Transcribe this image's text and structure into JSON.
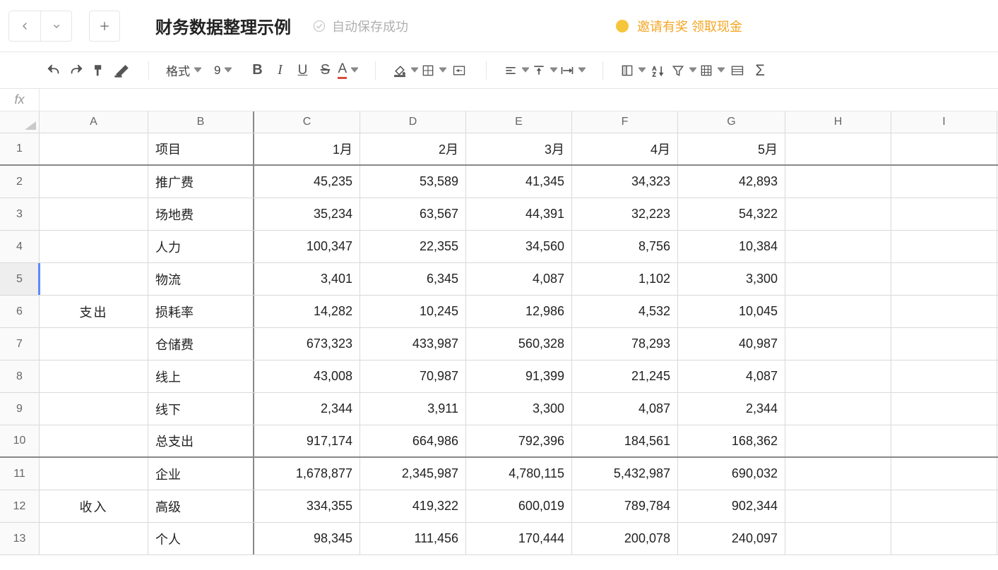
{
  "header": {
    "title": "财务数据整理示例",
    "save_status": "自动保存成功",
    "promo": "邀请有奖 领取现金"
  },
  "toolbar": {
    "format_label": "格式",
    "font_size": "9"
  },
  "formula_bar": {
    "label": "fx",
    "value": ""
  },
  "columns": [
    "A",
    "B",
    "C",
    "D",
    "E",
    "F",
    "G",
    "H",
    "I"
  ],
  "column_widths": [
    "colA",
    "colB",
    "colC",
    "colD",
    "colE",
    "colF",
    "colG",
    "colH",
    "colI"
  ],
  "rows": [
    {
      "n": "1",
      "a": "",
      "b": "项目",
      "c": "1月",
      "d": "2月",
      "e": "3月",
      "f": "4月",
      "g": "5月",
      "header": true
    },
    {
      "n": "2",
      "a": "",
      "b": "推广费",
      "c": "45,235",
      "d": "53,589",
      "e": "41,345",
      "f": "34,323",
      "g": "42,893"
    },
    {
      "n": "3",
      "a": "",
      "b": "场地费",
      "c": "35,234",
      "d": "63,567",
      "e": "44,391",
      "f": "32,223",
      "g": "54,322"
    },
    {
      "n": "4",
      "a": "",
      "b": "人力",
      "c": "100,347",
      "d": "22,355",
      "e": "34,560",
      "f": "8,756",
      "g": "10,384"
    },
    {
      "n": "5",
      "a": "",
      "b": "物流",
      "c": "3,401",
      "d": "6,345",
      "e": "4,087",
      "f": "1,102",
      "g": "3,300",
      "sel": true
    },
    {
      "n": "6",
      "a": "支出",
      "b": "损耗率",
      "c": "14,282",
      "d": "10,245",
      "e": "12,986",
      "f": "4,532",
      "g": "10,045"
    },
    {
      "n": "7",
      "a": "",
      "b": "仓储费",
      "c": "673,323",
      "d": "433,987",
      "e": "560,328",
      "f": "78,293",
      "g": "40,987"
    },
    {
      "n": "8",
      "a": "",
      "b": "线上",
      "c": "43,008",
      "d": "70,987",
      "e": "91,399",
      "f": "21,245",
      "g": "4,087"
    },
    {
      "n": "9",
      "a": "",
      "b": "线下",
      "c": "2,344",
      "d": "3,911",
      "e": "3,300",
      "f": "4,087",
      "g": "2,344"
    },
    {
      "n": "10",
      "a": "",
      "b": "总支出",
      "c": "917,174",
      "d": "664,986",
      "e": "792,396",
      "f": "184,561",
      "g": "168,362",
      "thick": true
    },
    {
      "n": "11",
      "a": "",
      "b": "企业",
      "c": "1,678,877",
      "d": "2,345,987",
      "e": "4,780,115",
      "f": "5,432,987",
      "g": "690,032"
    },
    {
      "n": "12",
      "a": "收入",
      "b": "高级",
      "c": "334,355",
      "d": "419,322",
      "e": "600,019",
      "f": "789,784",
      "g": "902,344"
    },
    {
      "n": "13",
      "a": "",
      "b": "个人",
      "c": "98,345",
      "d": "111,456",
      "e": "170,444",
      "f": "200,078",
      "g": "240,097"
    }
  ],
  "cat_spans": {
    "支出": {
      "from": 2,
      "to": 10
    },
    "收入": {
      "from": 11,
      "to": 13
    }
  }
}
